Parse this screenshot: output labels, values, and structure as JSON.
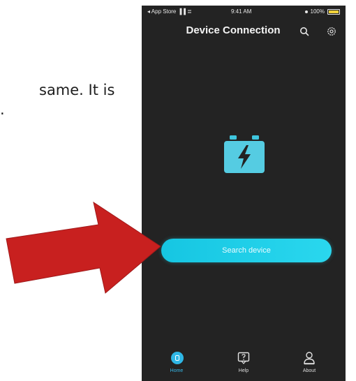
{
  "document": {
    "line1": "same. It is",
    "line2": "."
  },
  "status_bar": {
    "carrier": "◂ App Store ▐▐ ≣",
    "time": "9:41 AM",
    "battery": "100%",
    "battery_color": "#f2d33a"
  },
  "nav": {
    "title": "Device Connection",
    "search_icon": "search-icon",
    "settings_icon": "gear-icon"
  },
  "main": {
    "logo_icon": "battery-lightning-icon",
    "search_button_label": "Search device",
    "accent_color": "#22cfea"
  },
  "tabs": [
    {
      "label": "Home",
      "icon": "home-icon",
      "active": true
    },
    {
      "label": "Help",
      "icon": "help-icon",
      "active": false
    },
    {
      "label": "About",
      "icon": "person-icon",
      "active": false
    }
  ],
  "annotation": {
    "arrow_color": "#c8201f",
    "arrow_icon": "red-arrow-icon"
  }
}
